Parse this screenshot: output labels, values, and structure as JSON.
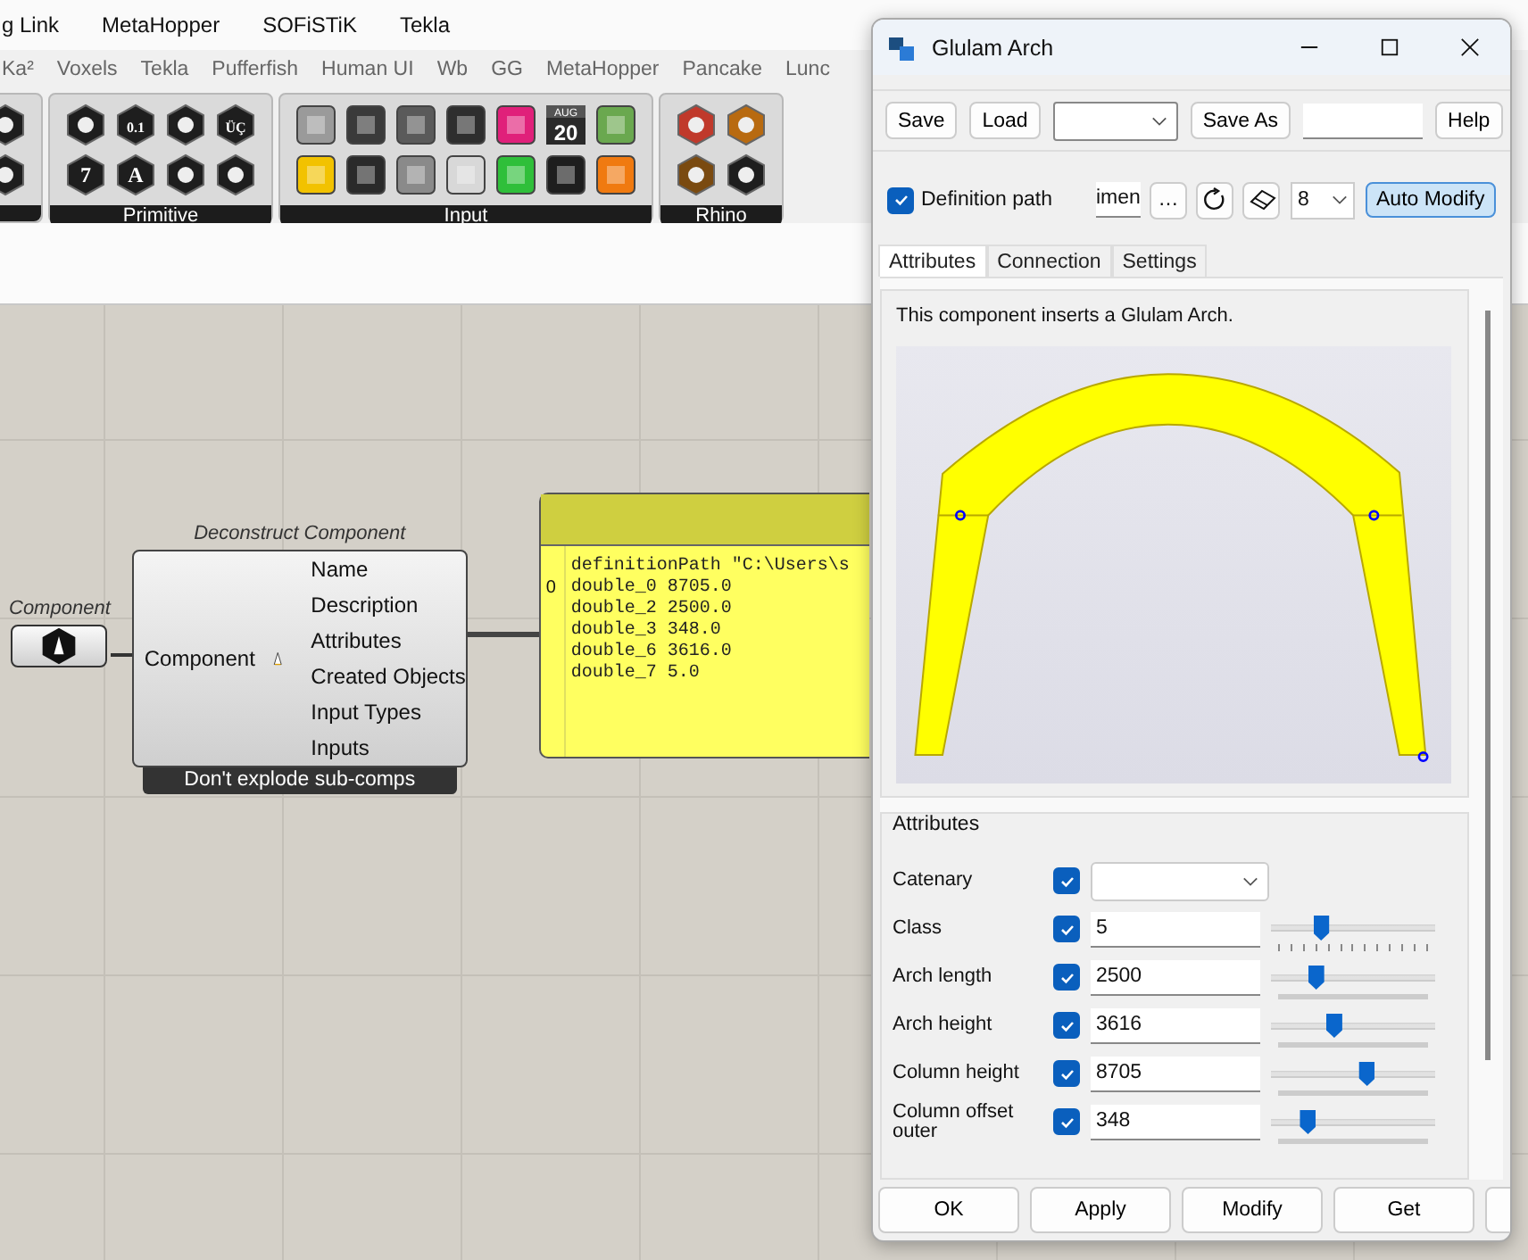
{
  "menu_bar": {
    "items": [
      "g Link",
      "MetaHopper",
      "SOFiSTiK",
      "Tekla"
    ]
  },
  "tab_bar": {
    "tabs": [
      "Ka²",
      "Voxels",
      "Tekla",
      "Pufferfish",
      "Human UI",
      "Wb",
      "GG",
      "MetaHopper",
      "Pancake",
      "Lunc"
    ]
  },
  "ribbon": {
    "groups": [
      {
        "icons": [
          {
            "kind": "hex",
            "color": "#1e1e1e"
          },
          {
            "kind": "hex",
            "color": "#1e1e1e"
          }
        ]
      },
      {
        "label": "Primitive",
        "icons": [
          {
            "kind": "hex",
            "color": "#1e1e1e"
          },
          {
            "kind": "hex",
            "color": "#1e1e1e",
            "glyph": "7"
          },
          {
            "kind": "hex",
            "color": "#1e1e1e",
            "glyph": "0.1"
          },
          {
            "kind": "hex",
            "color": "#1e1e1e",
            "glyph": "A"
          },
          {
            "kind": "hex",
            "color": "#1e1e1e"
          },
          {
            "kind": "hex",
            "color": "#1e1e1e"
          },
          {
            "kind": "hex",
            "color": "#1e1e1e",
            "glyph": "ÜÇ"
          },
          {
            "kind": "hex",
            "color": "#1e1e1e"
          }
        ]
      },
      {
        "label": "Input",
        "icons": [
          {
            "kind": "tile",
            "color": "#9a9a9a"
          },
          {
            "kind": "tile",
            "color": "#f2c200"
          },
          {
            "kind": "tile",
            "color": "#3a3a3a"
          },
          {
            "kind": "tile",
            "color": "#2a2a2a"
          },
          {
            "kind": "tile",
            "color": "#5a5a5a"
          },
          {
            "kind": "tile",
            "color": "#8a8a8a"
          },
          {
            "kind": "tile",
            "color": "#2e2e2e"
          },
          {
            "kind": "tile",
            "color": "#d8d8d8"
          },
          {
            "kind": "tile",
            "color": "#e0207a"
          },
          {
            "kind": "tile",
            "color": "#2fbf3a"
          },
          {
            "kind": "calendar",
            "color": "#2a2a2a",
            "month": "AUG",
            "day": "20"
          },
          {
            "kind": "tile",
            "color": "#1e1e1e"
          },
          {
            "kind": "tile",
            "color": "#6aa84f"
          },
          {
            "kind": "tile",
            "color": "#f07a10"
          }
        ]
      },
      {
        "label": "Rhino",
        "icons": [
          {
            "kind": "hex",
            "color": "#c0392b"
          },
          {
            "kind": "hex",
            "color": "#7a4a10"
          },
          {
            "kind": "hex",
            "color": "#b86a10"
          },
          {
            "kind": "hex",
            "color": "#1e1e1e"
          }
        ]
      }
    ]
  },
  "canvas": {
    "param": {
      "label": "Component"
    },
    "component": {
      "title": "Deconstruct Component",
      "input": "Component",
      "outputs": [
        "Name",
        "Description",
        "Attributes",
        "Created Objects",
        "Input Types",
        "Inputs"
      ],
      "footer": "Don't explode sub-comps"
    },
    "panel": {
      "index": "0",
      "lines": [
        "definitionPath \"C:\\Users\\s",
        "double_0 8705.0",
        "double_2 2500.0",
        "double_3 348.0",
        "double_6 3616.0",
        "double_7 5.0"
      ]
    }
  },
  "dialog": {
    "title": "Glulam Arch",
    "toolbar": [
      {
        "kind": "button",
        "label": "Save"
      },
      {
        "kind": "button",
        "label": "Load"
      },
      {
        "kind": "dropdown"
      },
      {
        "kind": "button",
        "label": "Save As"
      },
      {
        "kind": "field"
      },
      {
        "kind": "button",
        "label": "Help"
      }
    ],
    "definition_path": {
      "label": "Definition path",
      "checked": true,
      "value": "imen"
    },
    "browse": "…",
    "preset": "8",
    "auto_modify": {
      "label": "Auto Modify",
      "on": true
    },
    "tabs": [
      {
        "label": "Attributes",
        "selected": true
      },
      {
        "label": "Connection",
        "selected": false
      },
      {
        "label": "Settings",
        "selected": false
      }
    ],
    "description": "This component inserts a Glulam Arch.",
    "attributes": {
      "title": "Attributes",
      "rows": [
        {
          "kind": "dropdown",
          "label": "Catenary",
          "checked": true
        },
        {
          "kind": "ticked_slider",
          "label": "Class",
          "checked": true,
          "value": "5",
          "level": 0.3
        },
        {
          "kind": "slider",
          "label": "Arch length",
          "checked": true,
          "value": "2500",
          "level": 0.27
        },
        {
          "kind": "slider",
          "label": "Arch height",
          "checked": true,
          "value": "3616",
          "level": 0.38
        },
        {
          "kind": "slider",
          "label": "Column height",
          "checked": true,
          "value": "8705",
          "level": 0.58
        },
        {
          "kind": "slider",
          "label": "Column offset outer",
          "checked": true,
          "value": "348",
          "level": 0.22
        }
      ]
    },
    "buttons": [
      "OK",
      "Apply",
      "Modify",
      "Get"
    ]
  }
}
